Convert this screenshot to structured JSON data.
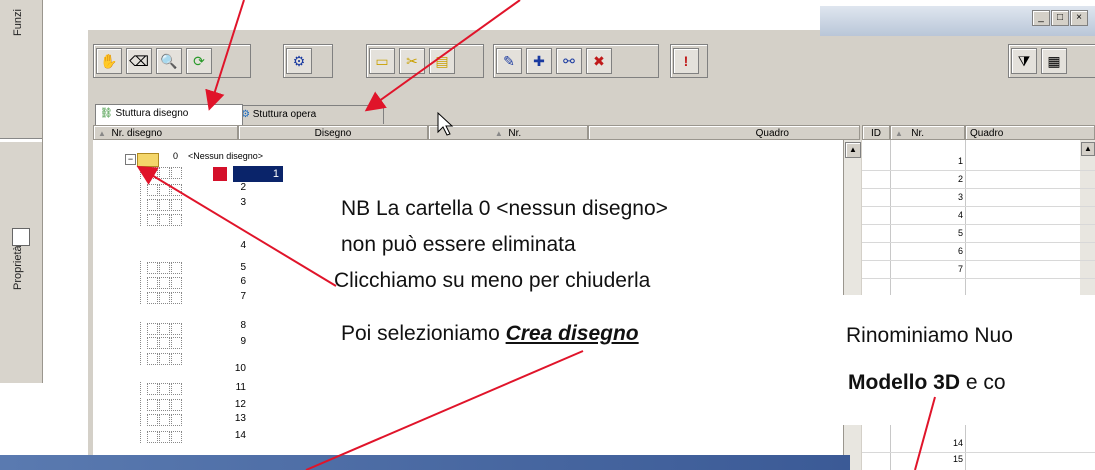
{
  "left_panel": {
    "top_label": "Funzi",
    "properties_label": "Proprietà"
  },
  "window": {
    "right_controls": [
      "_",
      "□",
      "×"
    ]
  },
  "toolbar": {
    "icons": [
      "select-icon",
      "erase-icon",
      "find-icon",
      "refresh-icon",
      "structure-icon",
      "new-folder-icon",
      "cut-folder-icon",
      "move-folder-icon",
      "pen-icon",
      "add-item-icon",
      "link-item-icon",
      "delete-item-icon",
      "alert-icon"
    ]
  },
  "tabs": [
    {
      "label": "Stuttura disegno"
    },
    {
      "label": "Stuttura opera"
    }
  ],
  "tree": {
    "columns": [
      "Nr. disegno",
      "Disegno",
      "Nr.",
      "Quadro"
    ],
    "root_number": "0",
    "root_label": "<Nessun disegno>",
    "rows": [
      "1",
      "2",
      "3",
      "4",
      "5",
      "6",
      "7",
      "8",
      "9",
      "10",
      "11",
      "12",
      "13",
      "14"
    ]
  },
  "right_table": {
    "columns": [
      "ID",
      "Nr.",
      "Quadro"
    ],
    "rows_top": [
      "1",
      "2",
      "3",
      "4",
      "5",
      "6",
      "7"
    ],
    "rows_bottom": [
      "14",
      "15"
    ]
  },
  "annotations": {
    "nb_line1": "NB La cartella 0 <nessun disegno>",
    "nb_line2": "non può essere eliminata",
    "nb_line3": "Clicchiamo su meno per  chiuderla",
    "poi_prefix": "Poi selezioniamo ",
    "poi_bold": "Crea disegno",
    "rinomin": "Rinominiamo Nuo",
    "modello_bold": "Modello 3D",
    "modello_suffix": " e  co"
  },
  "colors": {
    "arrow": "#e0142a",
    "selected_row": "#0a246a",
    "window_bg": "#d4d0c8"
  }
}
